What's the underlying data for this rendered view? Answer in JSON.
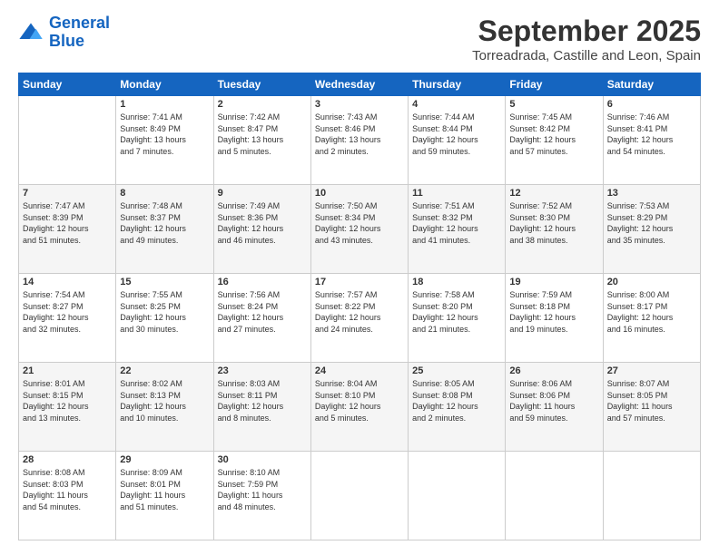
{
  "logo": {
    "line1": "General",
    "line2": "Blue"
  },
  "title": "September 2025",
  "subtitle": "Torreadrada, Castille and Leon, Spain",
  "weekdays": [
    "Sunday",
    "Monday",
    "Tuesday",
    "Wednesday",
    "Thursday",
    "Friday",
    "Saturday"
  ],
  "weeks": [
    [
      {
        "day": "",
        "info": ""
      },
      {
        "day": "1",
        "info": "Sunrise: 7:41 AM\nSunset: 8:49 PM\nDaylight: 13 hours\nand 7 minutes."
      },
      {
        "day": "2",
        "info": "Sunrise: 7:42 AM\nSunset: 8:47 PM\nDaylight: 13 hours\nand 5 minutes."
      },
      {
        "day": "3",
        "info": "Sunrise: 7:43 AM\nSunset: 8:46 PM\nDaylight: 13 hours\nand 2 minutes."
      },
      {
        "day": "4",
        "info": "Sunrise: 7:44 AM\nSunset: 8:44 PM\nDaylight: 12 hours\nand 59 minutes."
      },
      {
        "day": "5",
        "info": "Sunrise: 7:45 AM\nSunset: 8:42 PM\nDaylight: 12 hours\nand 57 minutes."
      },
      {
        "day": "6",
        "info": "Sunrise: 7:46 AM\nSunset: 8:41 PM\nDaylight: 12 hours\nand 54 minutes."
      }
    ],
    [
      {
        "day": "7",
        "info": "Sunrise: 7:47 AM\nSunset: 8:39 PM\nDaylight: 12 hours\nand 51 minutes."
      },
      {
        "day": "8",
        "info": "Sunrise: 7:48 AM\nSunset: 8:37 PM\nDaylight: 12 hours\nand 49 minutes."
      },
      {
        "day": "9",
        "info": "Sunrise: 7:49 AM\nSunset: 8:36 PM\nDaylight: 12 hours\nand 46 minutes."
      },
      {
        "day": "10",
        "info": "Sunrise: 7:50 AM\nSunset: 8:34 PM\nDaylight: 12 hours\nand 43 minutes."
      },
      {
        "day": "11",
        "info": "Sunrise: 7:51 AM\nSunset: 8:32 PM\nDaylight: 12 hours\nand 41 minutes."
      },
      {
        "day": "12",
        "info": "Sunrise: 7:52 AM\nSunset: 8:30 PM\nDaylight: 12 hours\nand 38 minutes."
      },
      {
        "day": "13",
        "info": "Sunrise: 7:53 AM\nSunset: 8:29 PM\nDaylight: 12 hours\nand 35 minutes."
      }
    ],
    [
      {
        "day": "14",
        "info": "Sunrise: 7:54 AM\nSunset: 8:27 PM\nDaylight: 12 hours\nand 32 minutes."
      },
      {
        "day": "15",
        "info": "Sunrise: 7:55 AM\nSunset: 8:25 PM\nDaylight: 12 hours\nand 30 minutes."
      },
      {
        "day": "16",
        "info": "Sunrise: 7:56 AM\nSunset: 8:24 PM\nDaylight: 12 hours\nand 27 minutes."
      },
      {
        "day": "17",
        "info": "Sunrise: 7:57 AM\nSunset: 8:22 PM\nDaylight: 12 hours\nand 24 minutes."
      },
      {
        "day": "18",
        "info": "Sunrise: 7:58 AM\nSunset: 8:20 PM\nDaylight: 12 hours\nand 21 minutes."
      },
      {
        "day": "19",
        "info": "Sunrise: 7:59 AM\nSunset: 8:18 PM\nDaylight: 12 hours\nand 19 minutes."
      },
      {
        "day": "20",
        "info": "Sunrise: 8:00 AM\nSunset: 8:17 PM\nDaylight: 12 hours\nand 16 minutes."
      }
    ],
    [
      {
        "day": "21",
        "info": "Sunrise: 8:01 AM\nSunset: 8:15 PM\nDaylight: 12 hours\nand 13 minutes."
      },
      {
        "day": "22",
        "info": "Sunrise: 8:02 AM\nSunset: 8:13 PM\nDaylight: 12 hours\nand 10 minutes."
      },
      {
        "day": "23",
        "info": "Sunrise: 8:03 AM\nSunset: 8:11 PM\nDaylight: 12 hours\nand 8 minutes."
      },
      {
        "day": "24",
        "info": "Sunrise: 8:04 AM\nSunset: 8:10 PM\nDaylight: 12 hours\nand 5 minutes."
      },
      {
        "day": "25",
        "info": "Sunrise: 8:05 AM\nSunset: 8:08 PM\nDaylight: 12 hours\nand 2 minutes."
      },
      {
        "day": "26",
        "info": "Sunrise: 8:06 AM\nSunset: 8:06 PM\nDaylight: 11 hours\nand 59 minutes."
      },
      {
        "day": "27",
        "info": "Sunrise: 8:07 AM\nSunset: 8:05 PM\nDaylight: 11 hours\nand 57 minutes."
      }
    ],
    [
      {
        "day": "28",
        "info": "Sunrise: 8:08 AM\nSunset: 8:03 PM\nDaylight: 11 hours\nand 54 minutes."
      },
      {
        "day": "29",
        "info": "Sunrise: 8:09 AM\nSunset: 8:01 PM\nDaylight: 11 hours\nand 51 minutes."
      },
      {
        "day": "30",
        "info": "Sunrise: 8:10 AM\nSunset: 7:59 PM\nDaylight: 11 hours\nand 48 minutes."
      },
      {
        "day": "",
        "info": ""
      },
      {
        "day": "",
        "info": ""
      },
      {
        "day": "",
        "info": ""
      },
      {
        "day": "",
        "info": ""
      }
    ]
  ]
}
